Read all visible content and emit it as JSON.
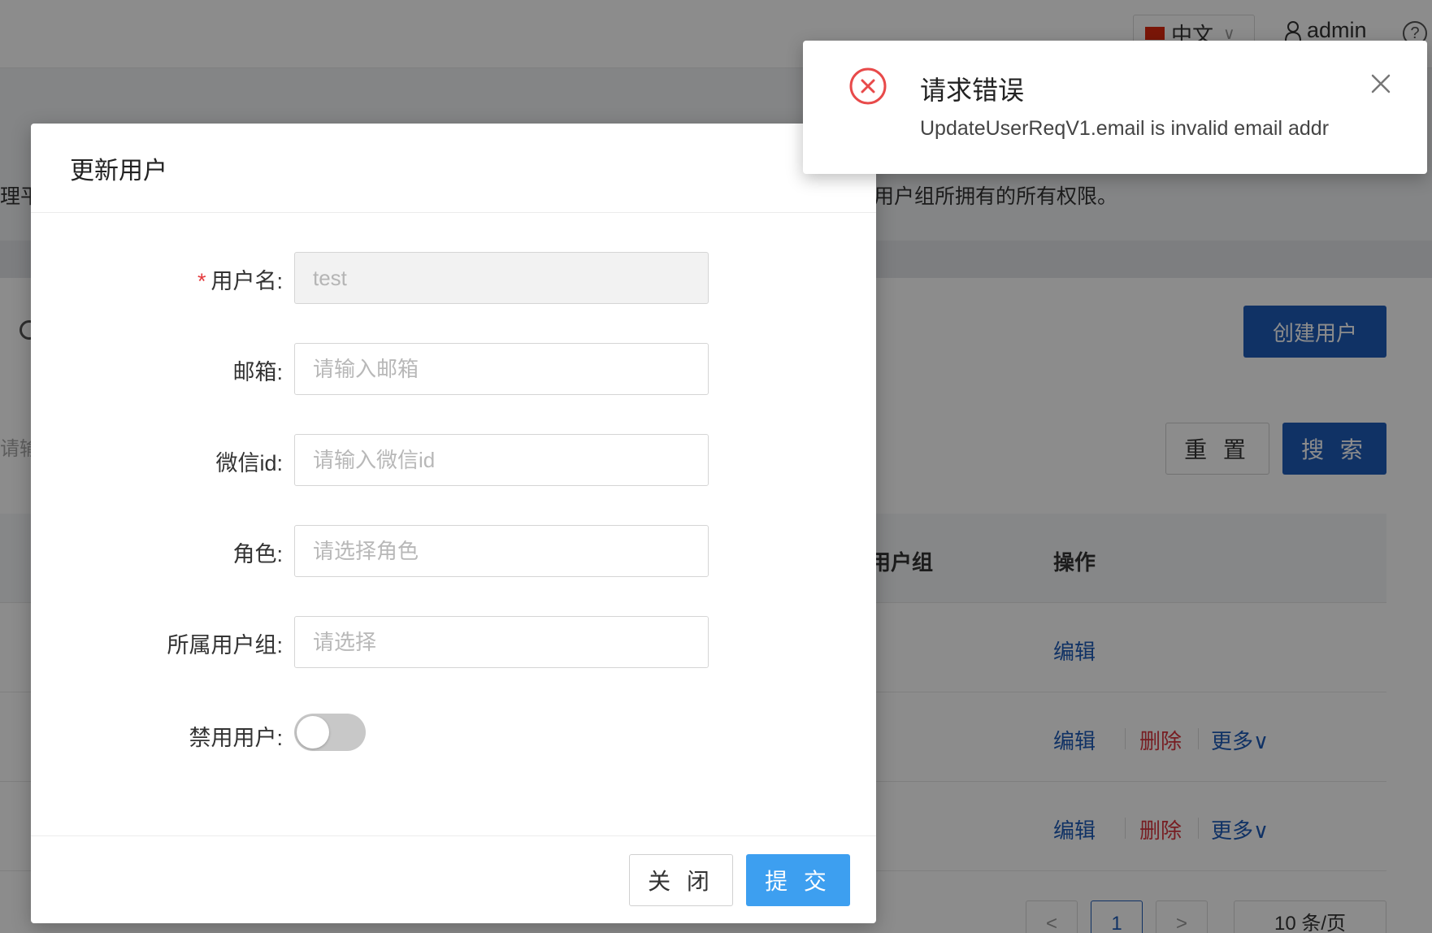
{
  "header": {
    "language": "中文",
    "username": "admin"
  },
  "page": {
    "description_left": "理平",
    "description_right": "用户组所拥有的所有权限。",
    "create_button": "创建用户",
    "search_placeholder_stub": "请输",
    "reset_button": "重 置",
    "search_button": "搜 索"
  },
  "table": {
    "columns": [
      "用户组",
      "操作"
    ],
    "rows": [
      {
        "actions": [
          "编辑"
        ]
      },
      {
        "actions": [
          "编辑",
          "删除",
          "更多∨"
        ]
      },
      {
        "actions": [
          "编辑",
          "删除",
          "更多∨"
        ]
      }
    ]
  },
  "pagination": {
    "prev": "<",
    "current_page": "1",
    "next": ">",
    "page_size": "10 条/页"
  },
  "modal": {
    "title": "更新用户",
    "fields": {
      "username": {
        "label": "用户名:",
        "value": "test",
        "required": true
      },
      "email": {
        "label": "邮箱:",
        "placeholder": "请输入邮箱"
      },
      "wechat": {
        "label": "微信id:",
        "placeholder": "请输入微信id"
      },
      "role": {
        "label": "角色:",
        "placeholder": "请选择角色"
      },
      "group": {
        "label": "所属用户组:",
        "placeholder": "请选择"
      },
      "disabled": {
        "label": "禁用用户:",
        "value": false
      }
    },
    "close_button": "关 闭",
    "submit_button": "提 交"
  },
  "notification": {
    "title": "请求错误",
    "message": "UpdateUserReqV1.email is invalid email addr",
    "icon": "error-circle-icon",
    "color": "#e84a4a"
  },
  "colors": {
    "primary": "#1e5bb8",
    "submit": "#3d9ff0",
    "danger": "#d9363e"
  }
}
